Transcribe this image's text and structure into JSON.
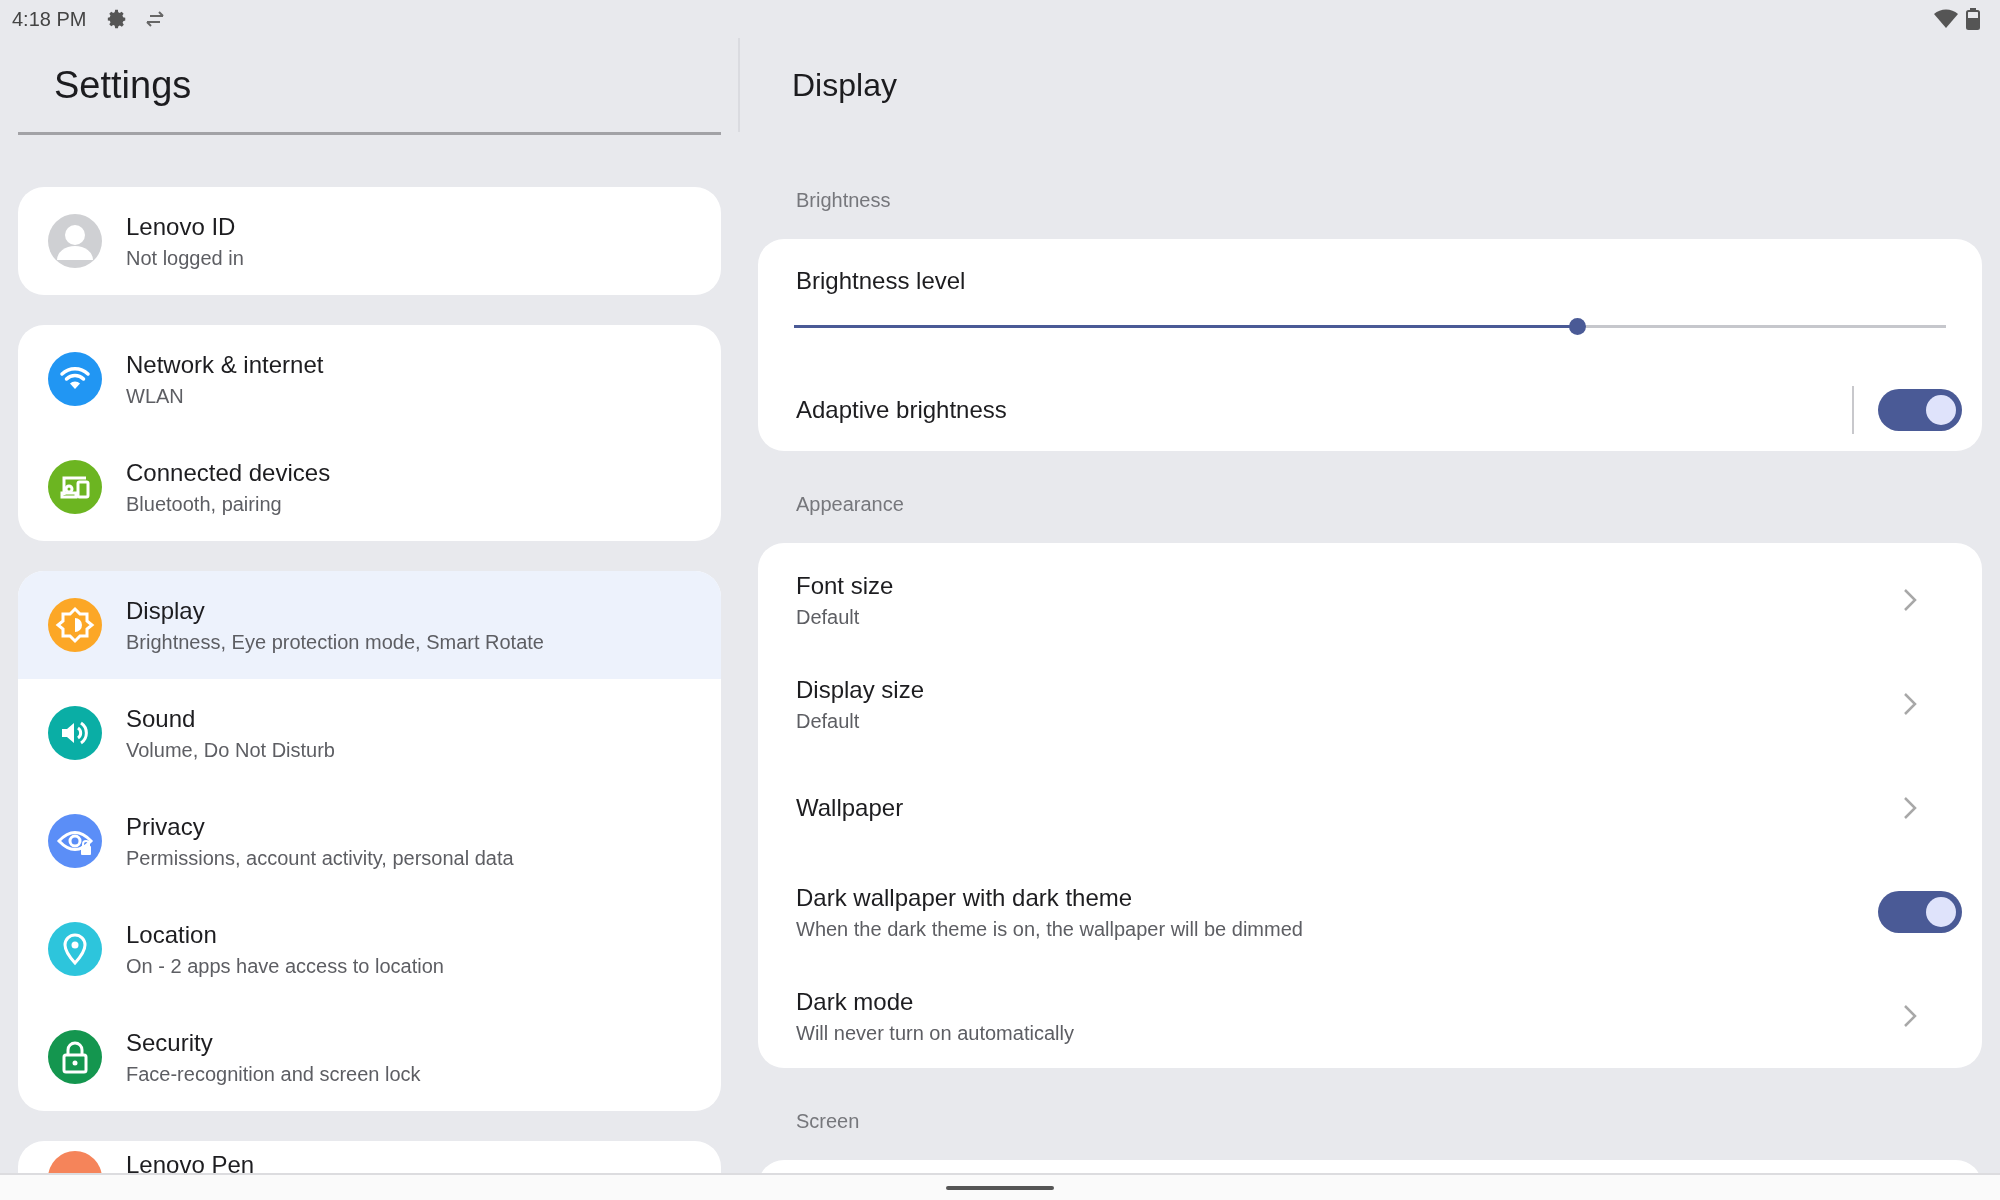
{
  "status_bar": {
    "time": "4:18 PM"
  },
  "left_pane": {
    "title": "Settings",
    "groups": [
      {
        "items": [
          {
            "title": "Lenovo ID",
            "subtitle": "Not logged in",
            "selected": false
          }
        ]
      },
      {
        "items": [
          {
            "title": "Network & internet",
            "subtitle": "WLAN",
            "selected": false
          },
          {
            "title": "Connected devices",
            "subtitle": "Bluetooth, pairing",
            "selected": false
          }
        ]
      },
      {
        "items": [
          {
            "title": "Display",
            "subtitle": "Brightness, Eye protection mode, Smart Rotate",
            "selected": true
          },
          {
            "title": "Sound",
            "subtitle": "Volume, Do Not Disturb",
            "selected": false
          },
          {
            "title": "Privacy",
            "subtitle": "Permissions, account activity, personal data",
            "selected": false
          },
          {
            "title": "Location",
            "subtitle": "On - 2 apps have access to location",
            "selected": false
          },
          {
            "title": "Security",
            "subtitle": "Face-recognition and screen lock",
            "selected": false
          }
        ]
      },
      {
        "items": [
          {
            "title": "Lenovo Pen",
            "selected": false
          }
        ]
      }
    ]
  },
  "right_pane": {
    "title": "Display",
    "sections": [
      {
        "header": "Brightness",
        "rows": [
          {
            "kind": "slider",
            "title": "Brightness level",
            "level": 0.68
          },
          {
            "kind": "split",
            "title": "Adaptive brightness",
            "on": true
          }
        ]
      },
      {
        "header": "Appearance",
        "rows": [
          {
            "kind": "link",
            "title": "Font size",
            "subtitle": "Default"
          },
          {
            "kind": "link",
            "title": "Display size",
            "subtitle": "Default"
          },
          {
            "kind": "link",
            "title": "Wallpaper"
          },
          {
            "kind": "toggle",
            "title": "Dark wallpaper with dark theme",
            "subtitle": "When the dark theme is on, the wallpaper will be dimmed",
            "on": true
          },
          {
            "kind": "link",
            "title": "Dark mode",
            "subtitle": "Will never turn on automatically"
          }
        ]
      },
      {
        "header": "Screen"
      }
    ]
  }
}
